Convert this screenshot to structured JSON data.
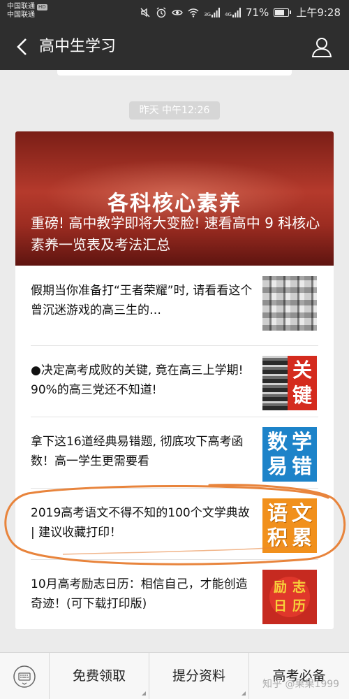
{
  "status_bar": {
    "carrier_1": "中国联通",
    "carrier_1_badge": "HD",
    "carrier_2": "中国联通",
    "network_1": "3G",
    "network_2": "4G",
    "battery": "71%",
    "time": "上午9:28"
  },
  "nav": {
    "title": "高中生学习",
    "back_icon": "chevron-left-icon",
    "profile_icon": "person-icon"
  },
  "chat": {
    "timestamp": "昨天 中午12:26",
    "card": {
      "banner": "各科核心素养",
      "title": "重磅! 高中教学即将大变脸! 速看高中 9 科核心素养一览表及考法汇总",
      "articles": [
        {
          "title": "假期当你准备打“王者荣耀”时, 请看看这个曾沉迷游戏的高三生的…",
          "thumb_text": []
        },
        {
          "title": "●决定高考成败的关键, 竟在高三上学期! 90%的高三党还不知道!",
          "thumb_text": [
            "关",
            "键"
          ]
        },
        {
          "title": "拿下这16道经典易错题, 彻底攻下高考函数！高一学生更需要看",
          "thumb_text": [
            "数",
            "学",
            "易",
            "错"
          ]
        },
        {
          "title": "2019高考语文不得不知的100个文学典故 | 建议收藏打印！",
          "thumb_text": [
            "语",
            "文",
            "积",
            "累"
          ]
        },
        {
          "title": "10月高考励志日历：相信自己，才能创造奇迹！(可下载打印版)",
          "thumb_text": [
            "励",
            "志",
            "日",
            "历"
          ]
        }
      ]
    }
  },
  "bottom_menu": {
    "keyboard_icon": "keyboard-icon",
    "items": [
      "免费领取",
      "提分资料",
      "高考必备"
    ]
  },
  "watermark": "知乎 @果果1999",
  "colors": {
    "bar": "#2e2e2e",
    "header_red": "#b53a2c",
    "highlight": "#e8843c"
  }
}
